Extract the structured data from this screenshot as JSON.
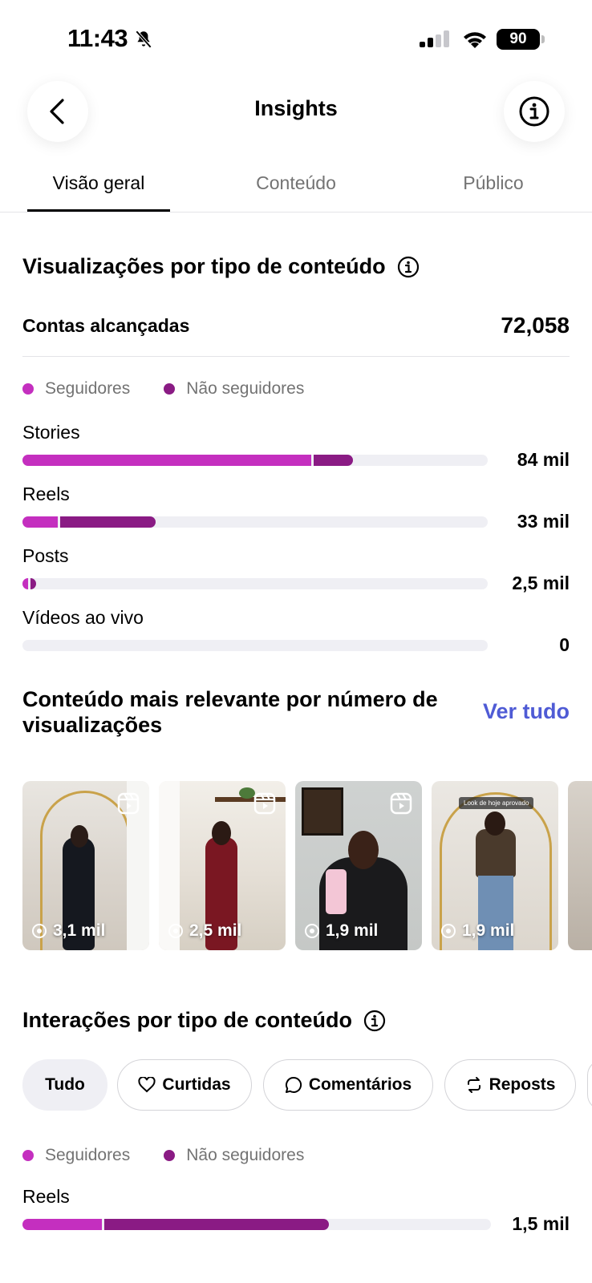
{
  "status_bar": {
    "time": "11:43",
    "battery": "90"
  },
  "header": {
    "title": "Insights"
  },
  "tabs": [
    {
      "label": "Visão geral",
      "active": true
    },
    {
      "label": "Conteúdo",
      "active": false
    },
    {
      "label": "Público",
      "active": false
    }
  ],
  "views_section": {
    "title": "Visualizações por tipo de conteúdo",
    "reach_label": "Contas alcançadas",
    "reach_value": "72,058",
    "legend": {
      "followers": "Seguidores",
      "non_followers": "Não seguidores"
    },
    "rows": [
      {
        "label": "Stories",
        "value": "84 mil",
        "followers_fraction": 0.62,
        "non_followers_fraction": 0.085
      },
      {
        "label": "Reels",
        "value": "33 mil",
        "followers_fraction": 0.075,
        "non_followers_fraction": 0.205
      },
      {
        "label": "Posts",
        "value": "2,5 mil",
        "followers_fraction": 0.012,
        "non_followers_fraction": 0.012
      },
      {
        "label": "Vídeos ao vivo",
        "value": "0",
        "followers_fraction": 0,
        "non_followers_fraction": 0
      }
    ]
  },
  "relevant_section": {
    "title": "Conteúdo mais relevante por número de visualizações",
    "see_all": "Ver tudo",
    "items": [
      {
        "views": "3,1 mil"
      },
      {
        "views": "2,5 mil"
      },
      {
        "views": "1,9 mil"
      },
      {
        "views": "1,9 mil",
        "caption": "Look de hoje aprovado"
      }
    ]
  },
  "interactions_section": {
    "title": "Interações por tipo de conteúdo",
    "chips": [
      {
        "label": "Tudo",
        "selected": true,
        "icon": ""
      },
      {
        "label": "Curtidas",
        "selected": false,
        "icon": "heart-icon"
      },
      {
        "label": "Comentários",
        "selected": false,
        "icon": "comment-icon"
      },
      {
        "label": "Reposts",
        "selected": false,
        "icon": "repost-icon"
      }
    ],
    "legend": {
      "followers": "Seguidores",
      "non_followers": "Não seguidores"
    },
    "rows": [
      {
        "label": "Reels",
        "value": "1,5 mil",
        "followers_fraction": 0.17,
        "non_followers_fraction": 0.48
      }
    ]
  },
  "colors": {
    "followers": "#c42fbf",
    "non_followers": "#8a1b84",
    "track": "#efeff4",
    "link": "#4f5bd5"
  }
}
